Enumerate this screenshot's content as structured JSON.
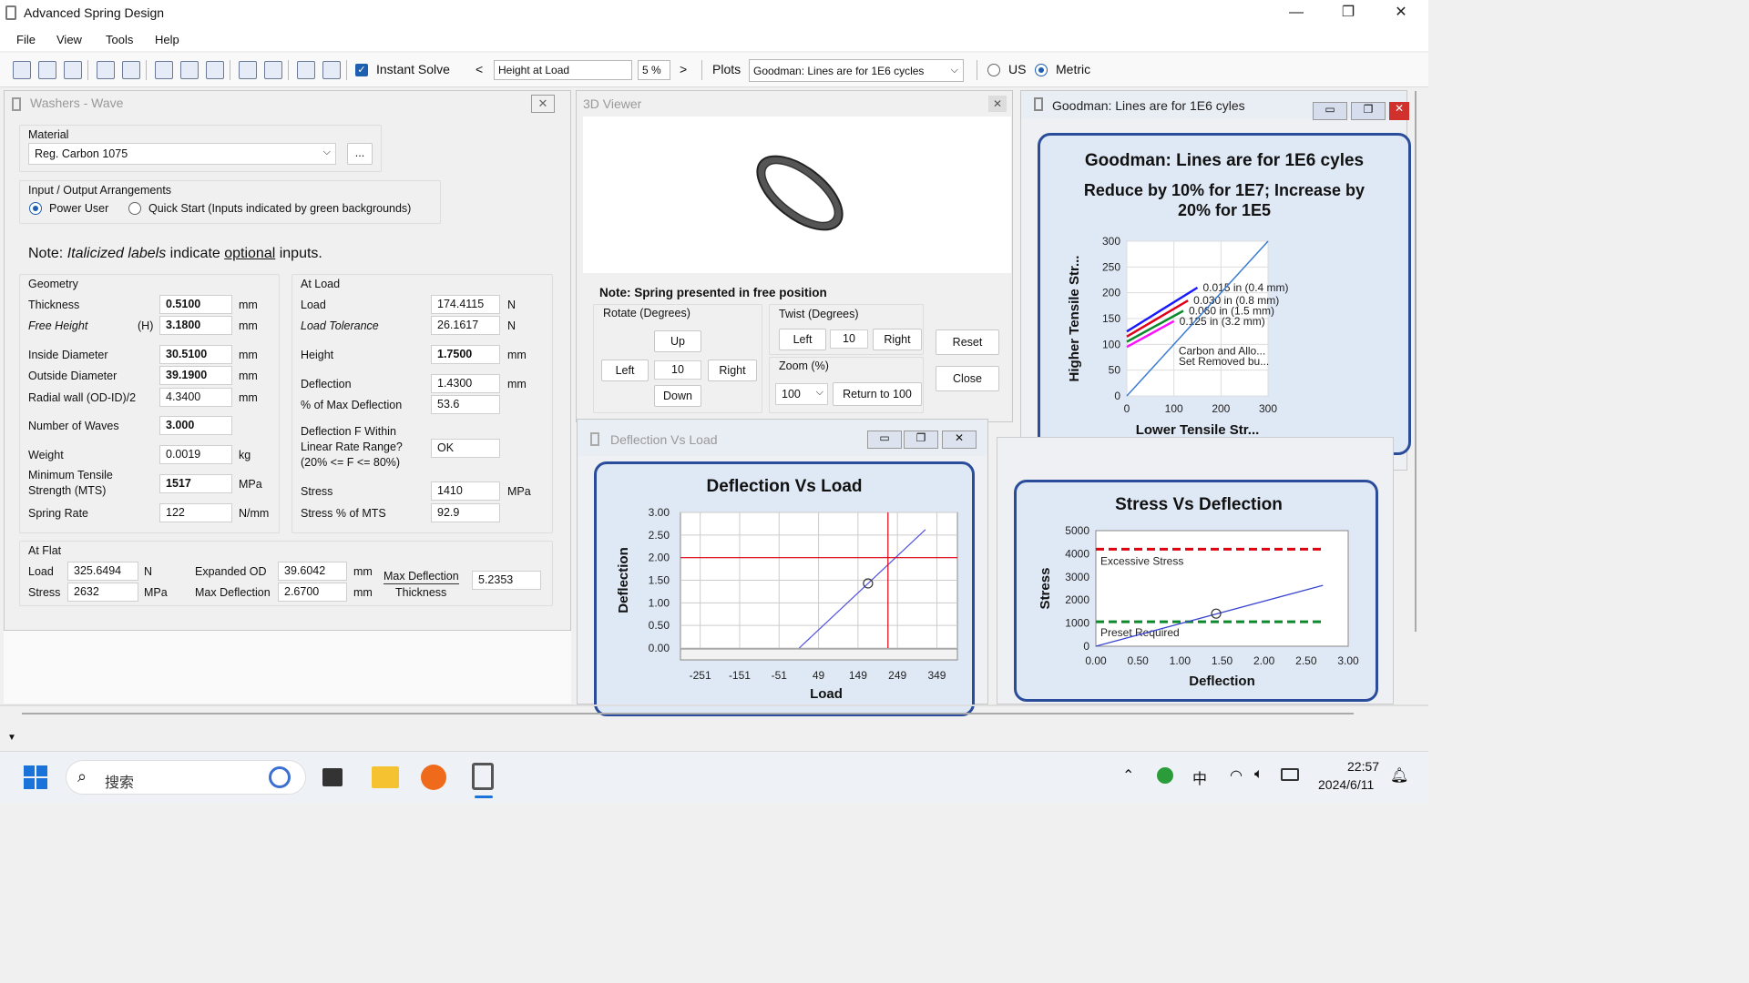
{
  "app": {
    "title": "Advanced Spring Design"
  },
  "menu": [
    "File",
    "View",
    "Tools",
    "Help"
  ],
  "toolbar": {
    "instant_solve": "Instant Solve",
    "lt": "<",
    "gt": ">",
    "target": "Height at Load",
    "percent": "5 %",
    "plots_label": "Plots",
    "plots_value": "Goodman:  Lines are for 1E6 cycles",
    "us": "US",
    "metric": "Metric",
    "unit_selected": "Metric"
  },
  "washers": {
    "title": "Washers - Wave",
    "material_label": "Material",
    "material_value": "Reg. Carbon 1075",
    "more": "...",
    "io_label": "Input / Output Arrangements",
    "power_user": "Power User",
    "quick_start": "Quick Start  (Inputs indicated by green backgrounds)",
    "note_pre": "Note:  ",
    "note_italic": "Italicized labels",
    "note_mid": " indicate ",
    "note_under": "optional",
    "note_post": " inputs.",
    "geometry": {
      "label": "Geometry",
      "rows": [
        {
          "label": "Thickness",
          "value": "0.5100",
          "unit": "mm"
        },
        {
          "label": "Free Height",
          "sym": "(H)",
          "value": "3.1800",
          "unit": "mm"
        },
        {
          "label": "Inside Diameter",
          "value": "30.5100",
          "unit": "mm"
        },
        {
          "label": "Outside Diameter",
          "value": "39.1900",
          "unit": "mm"
        },
        {
          "label": "Radial wall  (OD-ID)/2",
          "value": "4.3400",
          "unit": "mm"
        },
        {
          "label": "Number of Waves",
          "value": "3.000"
        },
        {
          "label": "Weight",
          "value": "0.0019",
          "unit": "kg"
        },
        {
          "label": "Minimum Tensile",
          "label2": "Strength  (MTS)",
          "value": "1517",
          "unit": "MPa"
        },
        {
          "label": "Spring Rate",
          "value": "122",
          "unit": "N/mm"
        }
      ]
    },
    "at_load": {
      "label": "At Load",
      "rows": [
        {
          "label": "Load",
          "value": "174.4115",
          "unit": "N"
        },
        {
          "label": "Load Tolerance",
          "value": "26.1617",
          "unit": "N"
        },
        {
          "label": "Height",
          "value": "1.7500",
          "unit": "mm"
        },
        {
          "label": "Deflection",
          "value": "1.4300",
          "unit": "mm"
        },
        {
          "label": "% of Max Deflection",
          "value": "53.6"
        },
        {
          "label": "Deflection F Within",
          "label2": "Linear Rate Range?",
          "label3": "(20% <=  F <= 80%)",
          "value": "OK"
        },
        {
          "label": "Stress",
          "value": "1410",
          "unit": "MPa"
        },
        {
          "label": "Stress % of MTS",
          "value": "92.9"
        }
      ]
    },
    "at_flat": {
      "label": "At Flat",
      "load_label": "Load",
      "load_value": "325.6494",
      "load_unit": "N",
      "stress_label": "Stress",
      "stress_value": "2632",
      "stress_unit": "MPa",
      "expod_label": "Expanded OD",
      "expod_value": "39.6042",
      "expod_unit": "mm",
      "maxdef_label": "Max Deflection",
      "maxdef_value": "2.6700",
      "maxdef_unit": "mm",
      "ratio_top": "Max Deflection",
      "ratio_bottom": "Thickness",
      "ratio_value": "5.2353"
    }
  },
  "viewer": {
    "title": "3D Viewer",
    "note": "Note: Spring presented in free position",
    "rotate_label": "Rotate (Degrees)",
    "up": "Up",
    "left": "Left",
    "right": "Right",
    "down": "Down",
    "rotate_value": "10",
    "twist_label": "Twist (Degrees)",
    "twist_left": "Left",
    "twist_value": "10",
    "twist_right": "Right",
    "zoom_label": "Zoom (%)",
    "zoom_value": "100",
    "return100": "Return to 100",
    "reset": "Reset",
    "close": "Close"
  },
  "goodman_window": {
    "title": "Goodman:  Lines are for 1E6 cyles"
  },
  "deflection_window": {
    "title": "Deflection Vs Load"
  },
  "chart_data": [
    {
      "type": "line",
      "title": "Goodman:  Lines are for 1E6 cyles",
      "subtitle": "Reduce by 10% for 1E7;  Increase by 20% for 1E5",
      "xlabel": "Lower  Tensile Str...",
      "ylabel": "Higher  Tensile Str...",
      "xlim": [
        0,
        300
      ],
      "ylim": [
        0,
        300
      ],
      "xticks": [
        "0",
        "100",
        "200",
        "300"
      ],
      "yticks": [
        "0",
        "50",
        "100",
        "150",
        "200",
        "250",
        "300"
      ],
      "series": [
        {
          "name": "0.015 in  (0.4 mm)",
          "color": "#1a1aff",
          "x": [
            0,
            150
          ],
          "y": [
            125,
            210
          ]
        },
        {
          "name": "0.030 in  (0.8 mm)",
          "color": "#e0001a",
          "x": [
            0,
            130
          ],
          "y": [
            115,
            185
          ]
        },
        {
          "name": "0.060 in  (1.5 mm)",
          "color": "#0a8a2a",
          "x": [
            0,
            120
          ],
          "y": [
            105,
            165
          ]
        },
        {
          "name": "0.125 in  (3.2 mm)",
          "color": "#ff10ff",
          "x": [
            0,
            100
          ],
          "y": [
            95,
            145
          ]
        },
        {
          "name": "diagonal",
          "color": "#3a7bd5",
          "x": [
            0,
            300
          ],
          "y": [
            0,
            300
          ]
        }
      ],
      "annotations": [
        "Carbon and Allo...",
        "Set Removed bu..."
      ]
    },
    {
      "type": "line",
      "title": "Deflection Vs Load",
      "xlabel": "Load",
      "ylabel": "Deflection",
      "xlim": [
        -301,
        401
      ],
      "ylim": [
        0,
        3
      ],
      "xticks": [
        "-251",
        "-151",
        "-51",
        "49",
        "149",
        "249",
        "349"
      ],
      "yticks": [
        "0.00",
        "0.50",
        "1.00",
        "1.50",
        "2.00",
        "2.50",
        "3.00"
      ],
      "series": [
        {
          "color": "#5050e0",
          "x": [
            0,
            320
          ],
          "y": [
            0,
            2.62
          ]
        }
      ],
      "point": {
        "x": 174.4,
        "y": 1.43
      },
      "hline": 2.0,
      "vline": 225
    },
    {
      "type": "line",
      "title": "Stress Vs Deflection",
      "xlabel": "Deflection",
      "ylabel": "Stress",
      "xlim": [
        0,
        3
      ],
      "ylim": [
        0,
        5000
      ],
      "xticks": [
        "0.00",
        "0.50",
        "1.00",
        "1.50",
        "2.00",
        "2.50",
        "3.00"
      ],
      "yticks": [
        "0",
        "1000",
        "2000",
        "3000",
        "4000",
        "5000"
      ],
      "series": [
        {
          "color": "#3a46d0",
          "x": [
            0,
            2.7
          ],
          "y": [
            0,
            2632
          ]
        }
      ],
      "point": {
        "x": 1.43,
        "y": 1410
      },
      "limits": [
        {
          "name": "Excessive Stress",
          "y": 4200,
          "color": "#e00010"
        },
        {
          "name": "Preset Required",
          "y": 1060,
          "color": "#0a8a2a"
        }
      ]
    }
  ],
  "taskbar": {
    "search": "搜索",
    "time": "22:57",
    "date": "2024/6/11",
    "ime": "中"
  }
}
